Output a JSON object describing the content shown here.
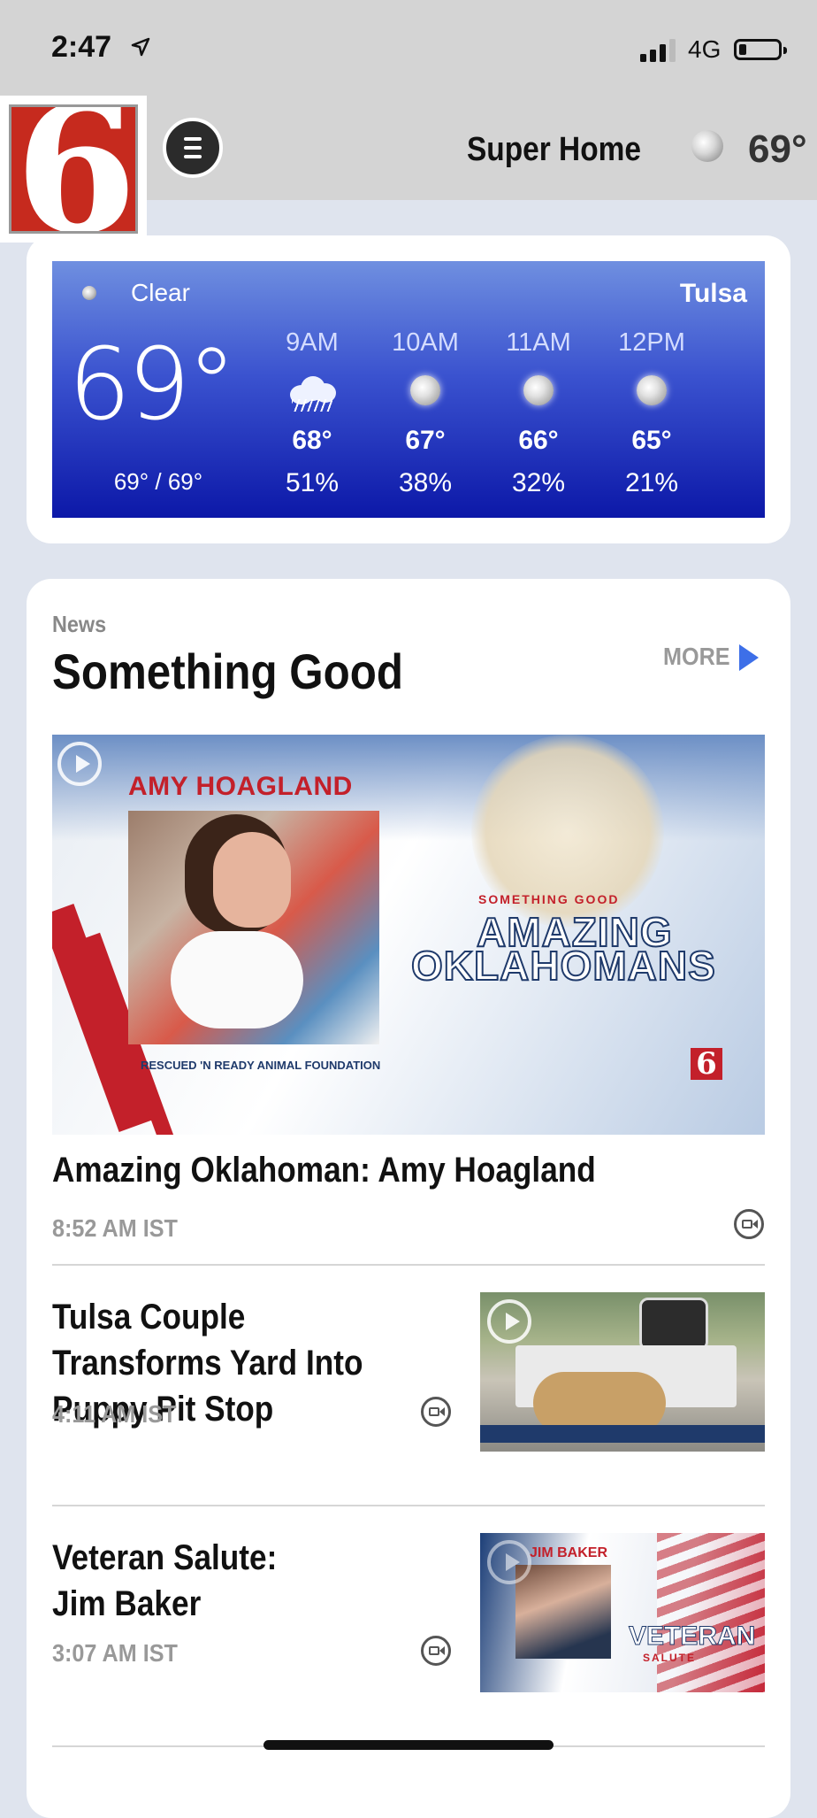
{
  "status_bar": {
    "time": "2:47",
    "network": "4G",
    "battery_level": 0.2
  },
  "header": {
    "logo_text": "6",
    "title": "Super Home",
    "weather_icon": "moon-icon",
    "temperature": "69°"
  },
  "weather": {
    "condition": "Clear",
    "city": "Tulsa",
    "current_temp": "69°",
    "high_low": "69° / 69°",
    "hourly": [
      {
        "time": "9AM",
        "icon": "rain-cloud-icon",
        "temp": "68°",
        "precip": "51%"
      },
      {
        "time": "10AM",
        "icon": "moon-icon",
        "temp": "67°",
        "precip": "38%"
      },
      {
        "time": "11AM",
        "icon": "moon-icon",
        "temp": "66°",
        "precip": "32%"
      },
      {
        "time": "12PM",
        "icon": "moon-icon",
        "temp": "65°",
        "precip": "21%"
      }
    ],
    "colors": {
      "top": "#6f8fe0",
      "bottom": "#0c18a8"
    }
  },
  "news": {
    "section": "News",
    "title": "Something Good",
    "more_label": "MORE",
    "featured": {
      "title": "Amazing Oklahoman: Amy Hoagland",
      "time": "8:52 AM IST",
      "image_text": {
        "name": "AMY HOAGLAND",
        "org": "RESCUED 'N READY ANIMAL FOUNDATION",
        "tag": "SOMETHING GOOD",
        "line1": "AMAZING",
        "line2": "OKLAHOMANS",
        "bug": "6"
      }
    },
    "articles": [
      {
        "title": "Tulsa Couple Transforms Yard Into Puppy Pit Stop",
        "time": "4:11 AM IST"
      },
      {
        "title": "Veteran Salute: Jim Baker",
        "time": "3:07 AM IST",
        "thumb_text": {
          "name": "JIM BAKER",
          "line": "VETERAN",
          "sub": "SALUTE"
        }
      }
    ]
  },
  "colors": {
    "accent_red": "#c3202a",
    "more_arrow": "#3d6fe8"
  }
}
